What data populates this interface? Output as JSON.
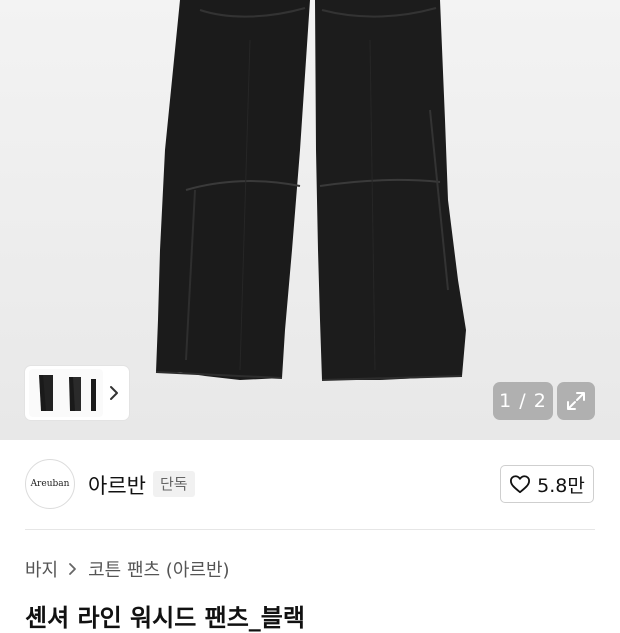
{
  "gallery": {
    "counter": "1 / 2",
    "icons": {
      "thumb_next": "chevron-right-icon",
      "expand": "expand-icon"
    }
  },
  "brand": {
    "logo_text": "Areuban",
    "name": "아르반",
    "badge": "단독",
    "likes": "5.8만",
    "icons": {
      "like": "heart-icon"
    }
  },
  "breadcrumb": {
    "category": "바지",
    "subcategory": "코튼 팬츠 (아르반)",
    "icons": {
      "separator": "chevron-right-icon"
    }
  },
  "product": {
    "title": "셴셔 라인 워시드 팬츠_블랙"
  }
}
